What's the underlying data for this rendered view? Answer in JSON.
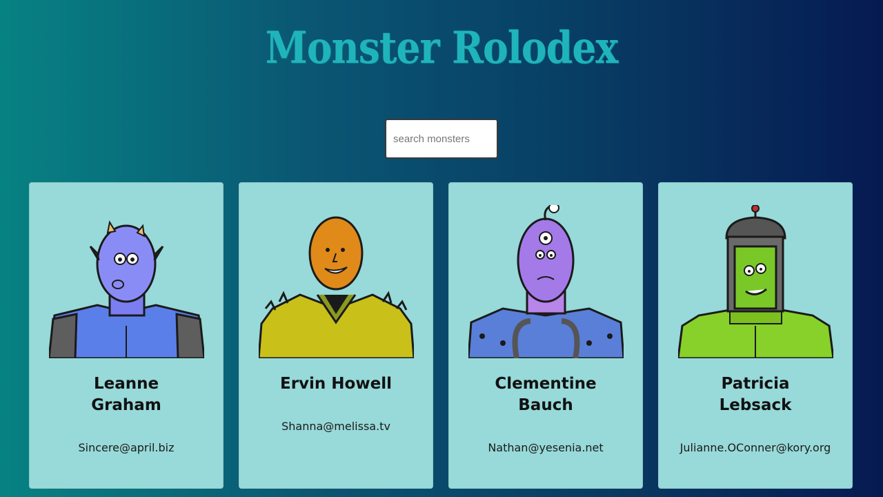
{
  "app": {
    "title": "Monster Rolodex"
  },
  "search": {
    "placeholder": "search monsters",
    "value": ""
  },
  "monsters": [
    {
      "name": "Leanne Graham",
      "email": "Sincere@april.biz",
      "avatar": "blue-horned-monster"
    },
    {
      "name": "Ervin Howell",
      "email": "Shanna@melissa.tv",
      "avatar": "orange-spiky-monster"
    },
    {
      "name": "Clementine Bauch",
      "email": "Nathan@yesenia.net",
      "avatar": "purple-cyclops-robot-monster"
    },
    {
      "name": "Patricia Lebsack",
      "email": "Julianne.OConner@kory.org",
      "avatar": "green-helmet-robot-monster"
    }
  ],
  "colors": {
    "background_start": "#078283",
    "background_end": "#061a52",
    "title": "#1fb4bb",
    "card": "#98d9d9"
  }
}
